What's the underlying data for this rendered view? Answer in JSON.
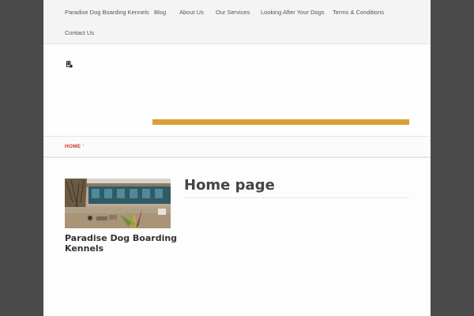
{
  "nav": {
    "items": [
      {
        "label": "Paradise Dog Boarding Kennels"
      },
      {
        "label": "Blog"
      },
      {
        "label": "About Us"
      },
      {
        "label": "Our Services"
      },
      {
        "label": "Looking After Your Dogs"
      },
      {
        "label": "Terms & Conditions"
      },
      {
        "label": "Contact Us"
      }
    ]
  },
  "header": {
    "icon": "mobile-phone-icon",
    "accent_color": "#d9a038"
  },
  "breadcrumb": {
    "home": "HOME",
    "separator": "›"
  },
  "sidebar": {
    "image": "kennel-photo",
    "title": "Paradise Dog Boarding Kennels"
  },
  "main": {
    "title": "Home page"
  }
}
